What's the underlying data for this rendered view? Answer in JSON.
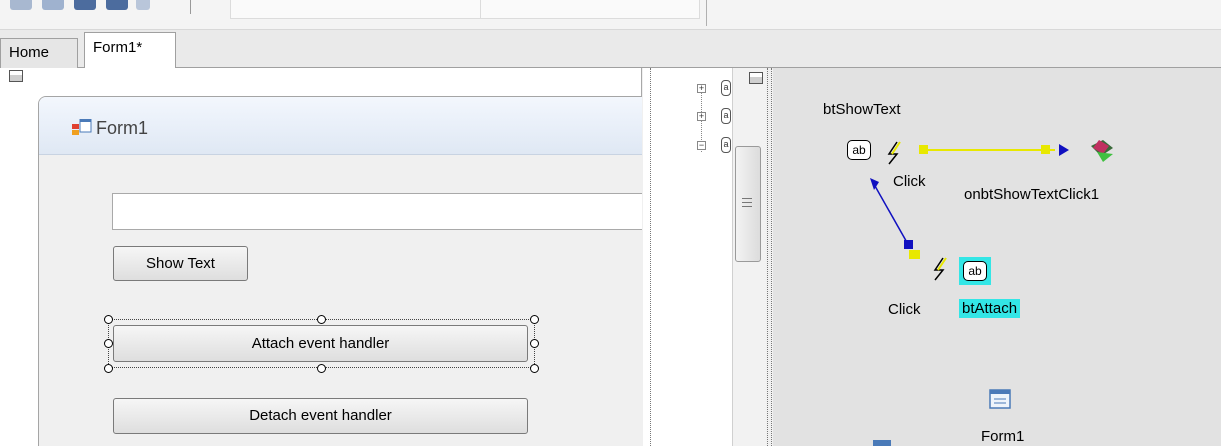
{
  "tabs": [
    {
      "label": "Home",
      "active": false
    },
    {
      "label": "Form1*",
      "active": true
    }
  ],
  "form": {
    "title": "Form1",
    "textbox_value": "",
    "buttons": {
      "show_text": "Show Text",
      "attach": "Attach event handler",
      "detach": "Detach event handler"
    }
  },
  "event_map": {
    "sources": [
      {
        "name": "btShowText",
        "icon": "ab",
        "event": "Click"
      },
      {
        "name": "btAttach",
        "icon": "ab",
        "event": "Click"
      }
    ],
    "handler": "onbtShowTextClick1",
    "form_component": "Form1"
  },
  "tree": {
    "expand_symbols": [
      "+",
      "+",
      "−"
    ]
  },
  "colors": {
    "link_line": "#e8e800",
    "arrow": "#1010c0",
    "selection": "#33e6e6",
    "canvas": "#e2e2e2"
  }
}
